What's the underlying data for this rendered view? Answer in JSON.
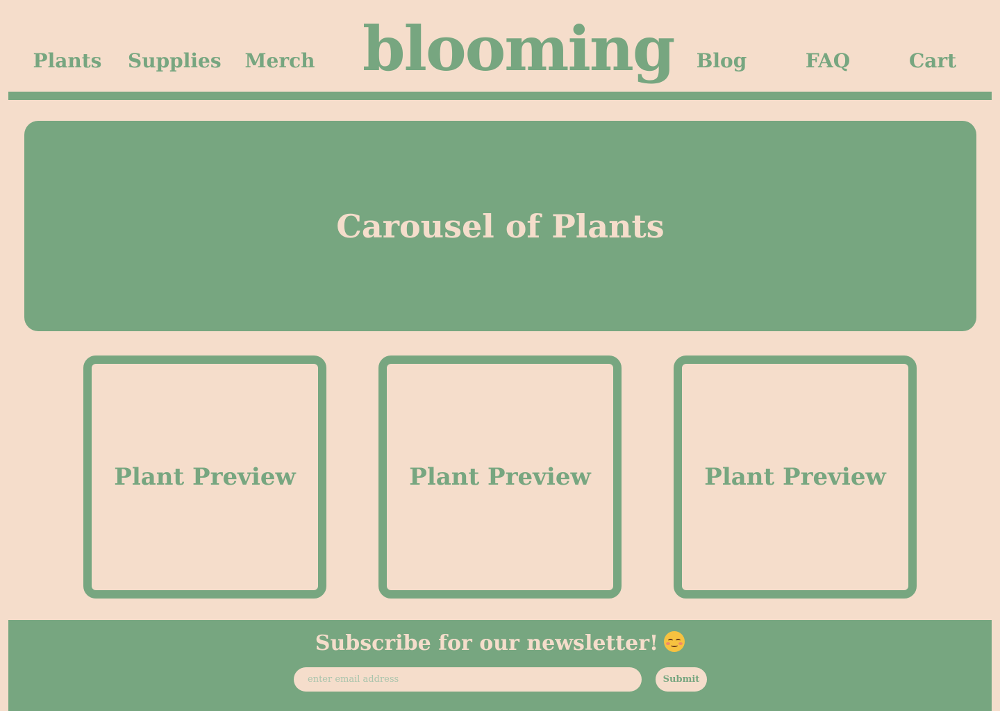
{
  "colors": {
    "background": "#f5ddcb",
    "accent": "#77a680",
    "text_on_accent": "#f5ddcb"
  },
  "header": {
    "logo": "blooming",
    "nav_left": [
      "Plants",
      "Supplies",
      "Merch"
    ],
    "nav_right": [
      "Blog",
      "FAQ",
      "Cart"
    ]
  },
  "carousel": {
    "title": "Carousel of Plants"
  },
  "previews": [
    {
      "label": "Plant Preview"
    },
    {
      "label": "Plant Preview"
    },
    {
      "label": "Plant Preview"
    }
  ],
  "newsletter": {
    "heading": "Subscribe for our newsletter!",
    "emoji_icon": "smiling-face-with-blush-icon",
    "email_placeholder": "enter email address",
    "email_value": "",
    "submit_label": "Submit"
  }
}
